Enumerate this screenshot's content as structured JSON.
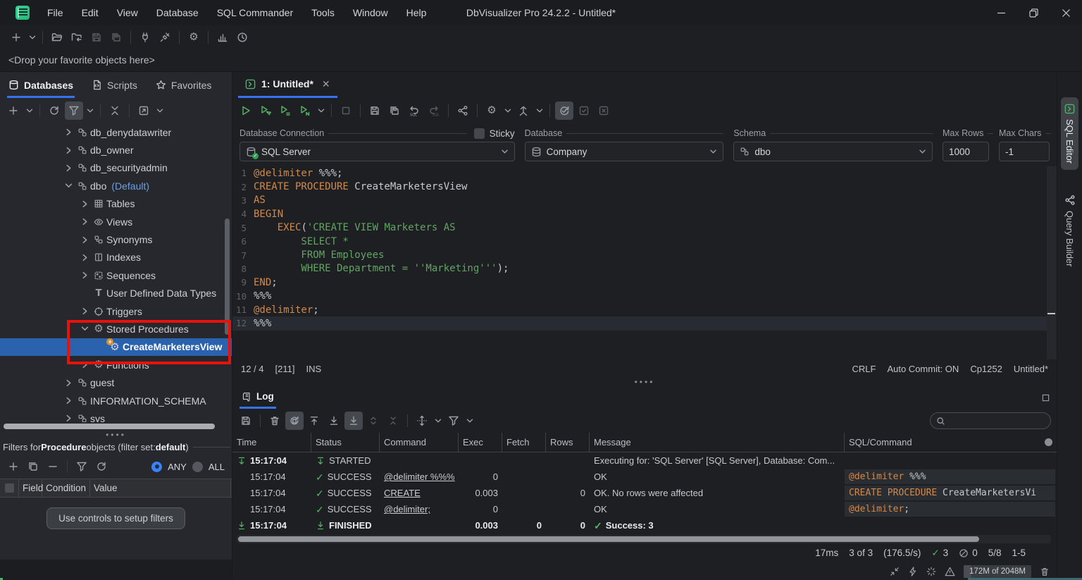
{
  "window": {
    "title": "DbVisualizer Pro 24.2.2 - Untitled*",
    "menus": [
      "File",
      "Edit",
      "View",
      "Database",
      "SQL Commander",
      "Tools",
      "Window",
      "Help"
    ]
  },
  "quick_toolbar": [
    {
      "n": "new",
      "i": "plus"
    },
    {
      "n": "new-options",
      "i": "chev"
    },
    {
      "sep": true
    },
    {
      "n": "open",
      "i": "folderOpen"
    },
    {
      "n": "import",
      "i": "folderImport"
    },
    {
      "n": "save",
      "i": "save",
      "s": "dim"
    },
    {
      "n": "save-all",
      "i": "saveAll",
      "s": "dim"
    },
    {
      "sep": true
    },
    {
      "n": "disconnect",
      "i": "plug"
    },
    {
      "n": "connect",
      "i": "connect"
    },
    {
      "sep": true
    },
    {
      "n": "tool-properties",
      "i": "gear"
    },
    {
      "sep": true
    },
    {
      "n": "charts",
      "i": "chart"
    },
    {
      "n": "history",
      "i": "history"
    }
  ],
  "drop_bar": {
    "text": "<Drop your favorite objects here>"
  },
  "sidebar": {
    "tabs": [
      {
        "label": "Databases",
        "icon": "dbCyl",
        "active": true
      },
      {
        "label": "Scripts",
        "icon": "script",
        "active": false
      },
      {
        "label": "Favorites",
        "icon": "star",
        "active": false
      }
    ],
    "toolbar": [
      {
        "n": "create-connection",
        "i": "plus"
      },
      {
        "n": "create-options",
        "i": "chev"
      },
      {
        "sep": true
      },
      {
        "n": "refresh-objects",
        "i": "refresh"
      },
      {
        "n": "filter-objects",
        "i": "funnel",
        "s": "hl"
      },
      {
        "n": "filter-options",
        "i": "chev"
      },
      {
        "sep": true
      },
      {
        "n": "collapse-all",
        "i": "collapseX"
      },
      {
        "sep": true
      },
      {
        "n": "open-in-new-window",
        "i": "openWin"
      },
      {
        "n": "open-options",
        "i": "chev"
      }
    ],
    "tree": [
      {
        "label": "db_denydatawriter",
        "indent": 3,
        "chevron": "right",
        "icon": "dbRole"
      },
      {
        "label": "db_owner",
        "indent": 3,
        "chevron": "right",
        "icon": "dbRole"
      },
      {
        "label": "db_securityadmin",
        "indent": 3,
        "chevron": "right",
        "icon": "dbRole"
      },
      {
        "label": "dbo",
        "extra": "(Default)",
        "indent": 3,
        "chevron": "down",
        "icon": "dbRole"
      },
      {
        "label": "Tables",
        "indent": 4,
        "chevron": "right",
        "icon": "tableGrid"
      },
      {
        "label": "Views",
        "indent": 4,
        "chevron": "right",
        "icon": "eye"
      },
      {
        "label": "Synonyms",
        "indent": 4,
        "chevron": "right",
        "icon": "synonym"
      },
      {
        "label": "Indexes",
        "indent": 4,
        "chevron": "right",
        "icon": "columnsIdx"
      },
      {
        "label": "Sequences",
        "indent": 4,
        "chevron": "right",
        "icon": "sequence"
      },
      {
        "label": "User Defined Data Types",
        "indent": 4,
        "chevron": null,
        "icon": "typeT"
      },
      {
        "label": "Triggers",
        "indent": 4,
        "chevron": "right",
        "icon": "trigger"
      },
      {
        "label": "Stored Procedures",
        "indent": 4,
        "chevron": "down",
        "icon": "gear"
      },
      {
        "label": "CreateMarketersView",
        "indent": 5,
        "chevron": null,
        "icon": "gearPlus",
        "selected": true
      },
      {
        "label": "Functions",
        "indent": 4,
        "chevron": "right",
        "icon": "gear"
      },
      {
        "label": "guest",
        "indent": 3,
        "chevron": "right",
        "icon": "dbRole"
      },
      {
        "label": "INFORMATION_SCHEMA",
        "indent": 3,
        "chevron": "right",
        "icon": "dbRole"
      },
      {
        "label": "sys",
        "indent": 3,
        "chevron": "right",
        "icon": "dbRole"
      }
    ],
    "filters": {
      "title_segments": [
        {
          "t": "Filters for ",
          "b": false
        },
        {
          "t": "Procedure",
          "b": true
        },
        {
          "t": " objects (filter set: ",
          "b": false
        },
        {
          "t": "default",
          "b": true
        },
        {
          "t": ")",
          "b": false
        }
      ],
      "toolbar": [
        {
          "n": "add-filter",
          "i": "plus"
        },
        {
          "n": "copy-filter",
          "i": "copy"
        },
        {
          "n": "remove-filter",
          "i": "minus"
        },
        {
          "sep": true
        },
        {
          "n": "apply-filter",
          "i": "funnel"
        },
        {
          "n": "reload-filter",
          "i": "refresh"
        }
      ],
      "match_any_label": "ANY",
      "match_all_label": "ALL",
      "columns": [
        "Field",
        "Condition",
        "Value"
      ],
      "empty_button": "Use controls to setup filters"
    }
  },
  "editor": {
    "tab_label": "1: Untitled*",
    "toolbar": [
      {
        "n": "execute",
        "i": "play",
        "s": "grn"
      },
      {
        "n": "execute-current",
        "i": "playCursor",
        "s": "grn"
      },
      {
        "n": "execute-buffer",
        "i": "playDoc",
        "s": "grn"
      },
      {
        "n": "execute-explain",
        "i": "playN",
        "s": "grn"
      },
      {
        "n": "execute-options",
        "i": "chev"
      },
      {
        "sep": true
      },
      {
        "n": "stop",
        "i": "stop",
        "s": "dim"
      },
      {
        "sep": true
      },
      {
        "n": "save-sql",
        "i": "save"
      },
      {
        "n": "save-sql-as",
        "i": "saveAll"
      },
      {
        "n": "undo-sql",
        "i": "undoSql"
      },
      {
        "n": "redo-sql",
        "i": "redoSql",
        "s": "dim"
      },
      {
        "sep": true
      },
      {
        "n": "query-builder-open",
        "i": "share"
      },
      {
        "sep": true
      },
      {
        "n": "editor-settings",
        "i": "gear"
      },
      {
        "n": "editor-settings-options",
        "i": "chev"
      },
      {
        "n": "format-sql",
        "i": "personArrow"
      },
      {
        "n": "format-options",
        "i": "chev"
      },
      {
        "sep": true
      },
      {
        "n": "auto-commit-toggle",
        "i": "autocommit",
        "s": "hl"
      },
      {
        "n": "commit",
        "i": "commitCheck",
        "s": "dim"
      },
      {
        "n": "rollback",
        "i": "rollbackX",
        "s": "dim"
      }
    ],
    "form": {
      "connection_label": "Database Connection",
      "connection_value": "SQL Server",
      "sticky_label": "Sticky",
      "database_label": "Database",
      "database_value": "Company",
      "schema_label": "Schema",
      "schema_value": "dbo",
      "max_rows_label": "Max Rows",
      "max_rows_value": "1000",
      "max_chars_label": "Max Chars",
      "max_chars_value": "-1"
    },
    "code": {
      "current_line": 12,
      "lines": [
        [
          {
            "t": "@delimiter",
            "c": "k"
          },
          {
            "t": " %%%;",
            "c": "p"
          }
        ],
        [
          {
            "t": "CREATE PROCEDURE",
            "c": "k"
          },
          {
            "t": " CreateMarketersView",
            "c": "p"
          }
        ],
        [
          {
            "t": "AS",
            "c": "k"
          }
        ],
        [
          {
            "t": "BEGIN",
            "c": "k"
          }
        ],
        [
          {
            "t": "    ",
            "c": "p"
          },
          {
            "t": "EXEC",
            "c": "k"
          },
          {
            "t": "(",
            "c": "p"
          },
          {
            "t": "'CREATE VIEW Marketers AS",
            "c": "s"
          }
        ],
        [
          {
            "t": "        SELECT *",
            "c": "s"
          }
        ],
        [
          {
            "t": "        FROM Employees",
            "c": "s"
          }
        ],
        [
          {
            "t": "        WHERE Department = ''Marketing'''",
            "c": "s"
          },
          {
            "t": ");",
            "c": "p"
          }
        ],
        [
          {
            "t": "END",
            "c": "k"
          },
          {
            "t": ";",
            "c": "p"
          }
        ],
        [
          {
            "t": "%%%",
            "c": "p"
          }
        ],
        [
          {
            "t": "@delimiter",
            "c": "k"
          },
          {
            "t": ";",
            "c": "p"
          }
        ],
        [
          {
            "t": "%%%",
            "c": "p"
          }
        ]
      ]
    },
    "status": {
      "caret": "12 / 4",
      "selection": "[211]",
      "mode": "INS",
      "line_ending": "CRLF",
      "auto_commit": "Auto Commit: ON",
      "encoding": "Cp1252",
      "doc": "Untitled*"
    }
  },
  "log": {
    "tab_label": "Log",
    "toolbar": [
      {
        "n": "export-log",
        "i": "save"
      },
      {
        "sep": true
      },
      {
        "n": "clear-log",
        "i": "trash"
      },
      {
        "n": "auto-clear-log",
        "i": "clearAuto",
        "s": "hl"
      },
      {
        "n": "scroll-to-top",
        "i": "scrollTop"
      },
      {
        "n": "scroll-to-bottom",
        "i": "scrollBottom"
      },
      {
        "n": "tail-log",
        "i": "scrollBottom",
        "s": "hl"
      },
      {
        "n": "expand-rows",
        "i": "expandRows",
        "s": "dim"
      },
      {
        "n": "collapse-rows",
        "i": "collapseRows",
        "s": "dim"
      },
      {
        "sep": true
      },
      {
        "n": "fit-columns",
        "i": "moveFit"
      },
      {
        "n": "fit-options",
        "i": "chev"
      },
      {
        "n": "filter-log",
        "i": "funnel"
      },
      {
        "n": "filter-log-options",
        "i": "chev"
      }
    ],
    "search_placeholder": "",
    "columns": [
      "Time",
      "Status",
      "Command",
      "Exec",
      "Fetch",
      "Rows",
      "Message",
      "SQL/Command"
    ],
    "rows": [
      {
        "time": "15:17:04",
        "time_bold": true,
        "time_icon": "started",
        "status_icon": "started",
        "status": "STARTED",
        "command": "",
        "exec": "",
        "fetch": "",
        "rows": "",
        "message": "Executing for: 'SQL Server' [SQL Server], Database: Com...",
        "sql": []
      },
      {
        "time": "15:17:04",
        "status_icon": "check",
        "status": "SUCCESS",
        "command": "@delimiter %%%",
        "command_link": true,
        "exec": "0",
        "fetch": "",
        "rows": "",
        "message": "OK",
        "sql": [
          {
            "t": "@delimiter",
            "c": "k"
          },
          {
            "t": " %%%",
            "c": "p"
          }
        ]
      },
      {
        "time": "15:17:04",
        "status_icon": "check",
        "status": "SUCCESS",
        "command": "CREATE",
        "command_link": true,
        "exec": "0.003",
        "fetch": "",
        "rows": "0",
        "message": "OK. No rows were affected",
        "sql": [
          {
            "t": "CREATE PROCEDURE",
            "c": "k"
          },
          {
            "t": " CreateMarketersVi",
            "c": "p"
          }
        ]
      },
      {
        "time": "15:17:04",
        "status_icon": "check",
        "status": "SUCCESS",
        "command": "@delimiter;",
        "command_link": true,
        "exec": "0",
        "fetch": "",
        "rows": "",
        "message": "OK",
        "sql": [
          {
            "t": "@delimiter",
            "c": "k"
          },
          {
            "t": ";",
            "c": "p"
          }
        ]
      },
      {
        "time": "15:17:04",
        "time_bold": true,
        "time_icon": "finished",
        "status_icon": "finished",
        "status": "FINISHED",
        "status_bold": true,
        "command": "",
        "exec": "0.003",
        "exec_bold": true,
        "fetch": "0",
        "fetch_bold": true,
        "rows": "0",
        "rows_bold": true,
        "message": "Success: 3",
        "message_check": true,
        "message_bold": true,
        "sql": []
      }
    ],
    "footer": {
      "time": "17ms",
      "count": "3 of 3",
      "rate": "(176.5/s)",
      "success_count": "3",
      "error_count": "0",
      "page": "5/8",
      "range": "1-5"
    },
    "memory": "172M of 2048M"
  },
  "right_panel": {
    "tabs": [
      {
        "label": "SQL Editor",
        "icon": "sqlTab",
        "active": true
      },
      {
        "label": "Query Builder",
        "icon": "share",
        "active": false
      }
    ]
  }
}
